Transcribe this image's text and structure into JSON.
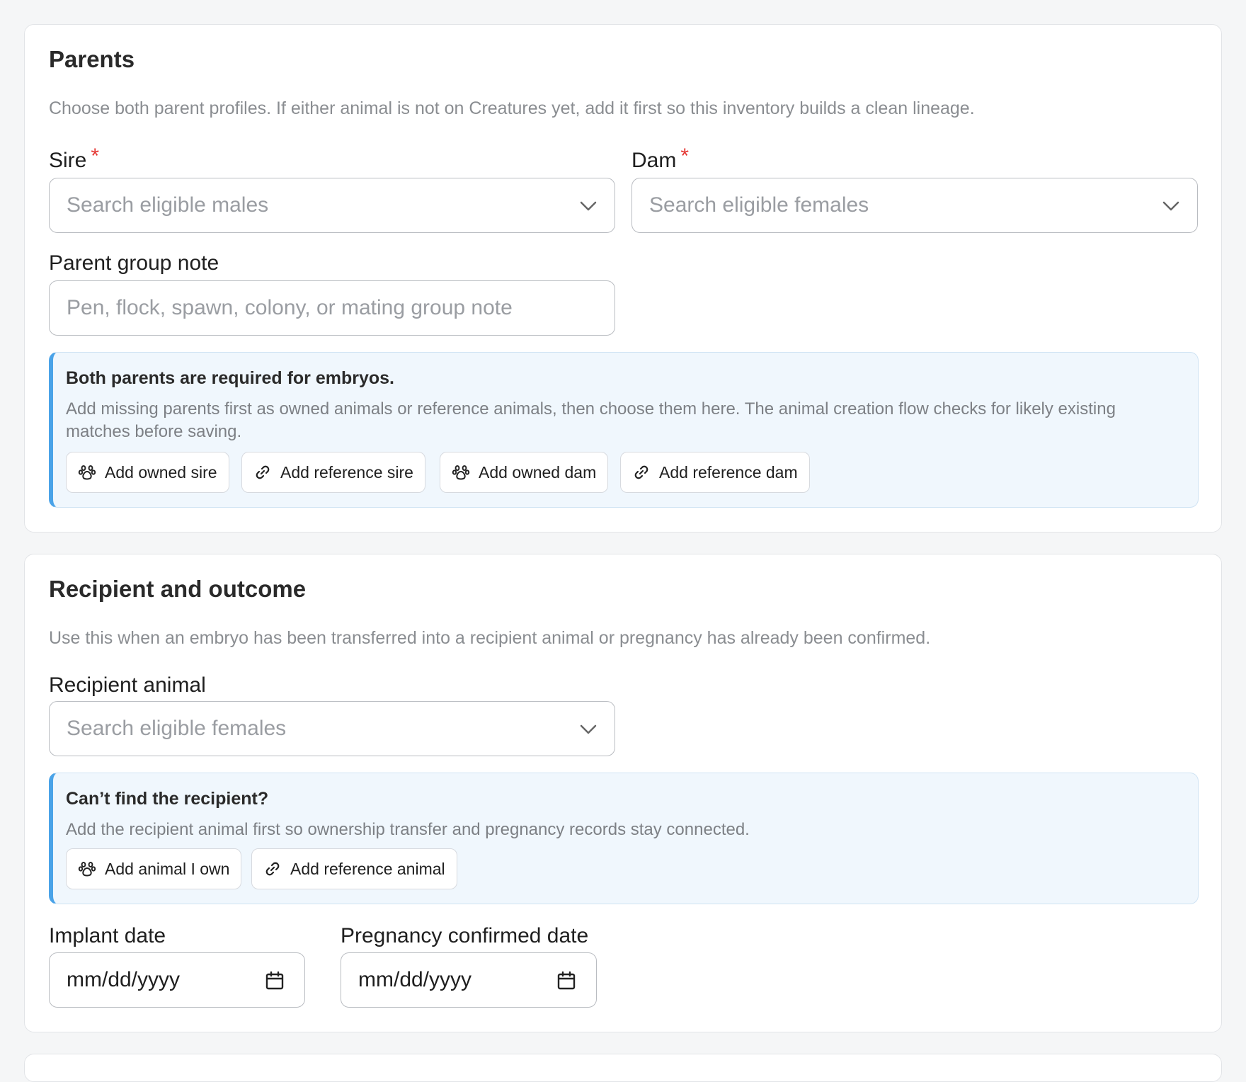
{
  "parents": {
    "title": "Parents",
    "description": "Choose both parent profiles. If either animal is not on Creatures yet, add it first so this inventory builds a clean lineage.",
    "sire_label": "Sire",
    "dam_label": "Dam",
    "required_mark": "*",
    "sire_placeholder": "Search eligible males",
    "dam_placeholder": "Search eligible females",
    "group_note_label": "Parent group note",
    "group_note_placeholder": "Pen, flock, spawn, colony, or mating group note",
    "callout": {
      "title": "Both parents are required for embryos.",
      "text": "Add missing parents first as owned animals or reference animals, then choose them here. The animal creation flow checks for likely existing matches before saving.",
      "buttons": [
        {
          "label": "Add owned sire",
          "icon": "paw-icon"
        },
        {
          "label": "Add reference sire",
          "icon": "link-icon"
        },
        {
          "label": "Add owned dam",
          "icon": "paw-icon"
        },
        {
          "label": "Add reference dam",
          "icon": "link-icon"
        }
      ]
    }
  },
  "recipient": {
    "title": "Recipient and outcome",
    "description": "Use this when an embryo has been transferred into a recipient animal or pregnancy has already been confirmed.",
    "recipient_label": "Recipient animal",
    "recipient_placeholder": "Search eligible females",
    "callout": {
      "title": "Can’t find the recipient?",
      "text": "Add the recipient animal first so ownership transfer and pregnancy records stay connected.",
      "buttons": [
        {
          "label": "Add animal I own",
          "icon": "paw-icon"
        },
        {
          "label": "Add reference animal",
          "icon": "link-icon"
        }
      ]
    },
    "implant_label": "Implant date",
    "implant_value": "mm/dd/yyyy",
    "pregnancy_label": "Pregnancy confirmed date",
    "pregnancy_value": "mm/dd/yyyy"
  },
  "colors": {
    "required": "#e53935",
    "callout_accent": "#4aa3e8",
    "callout_bg": "#f0f7fd"
  }
}
